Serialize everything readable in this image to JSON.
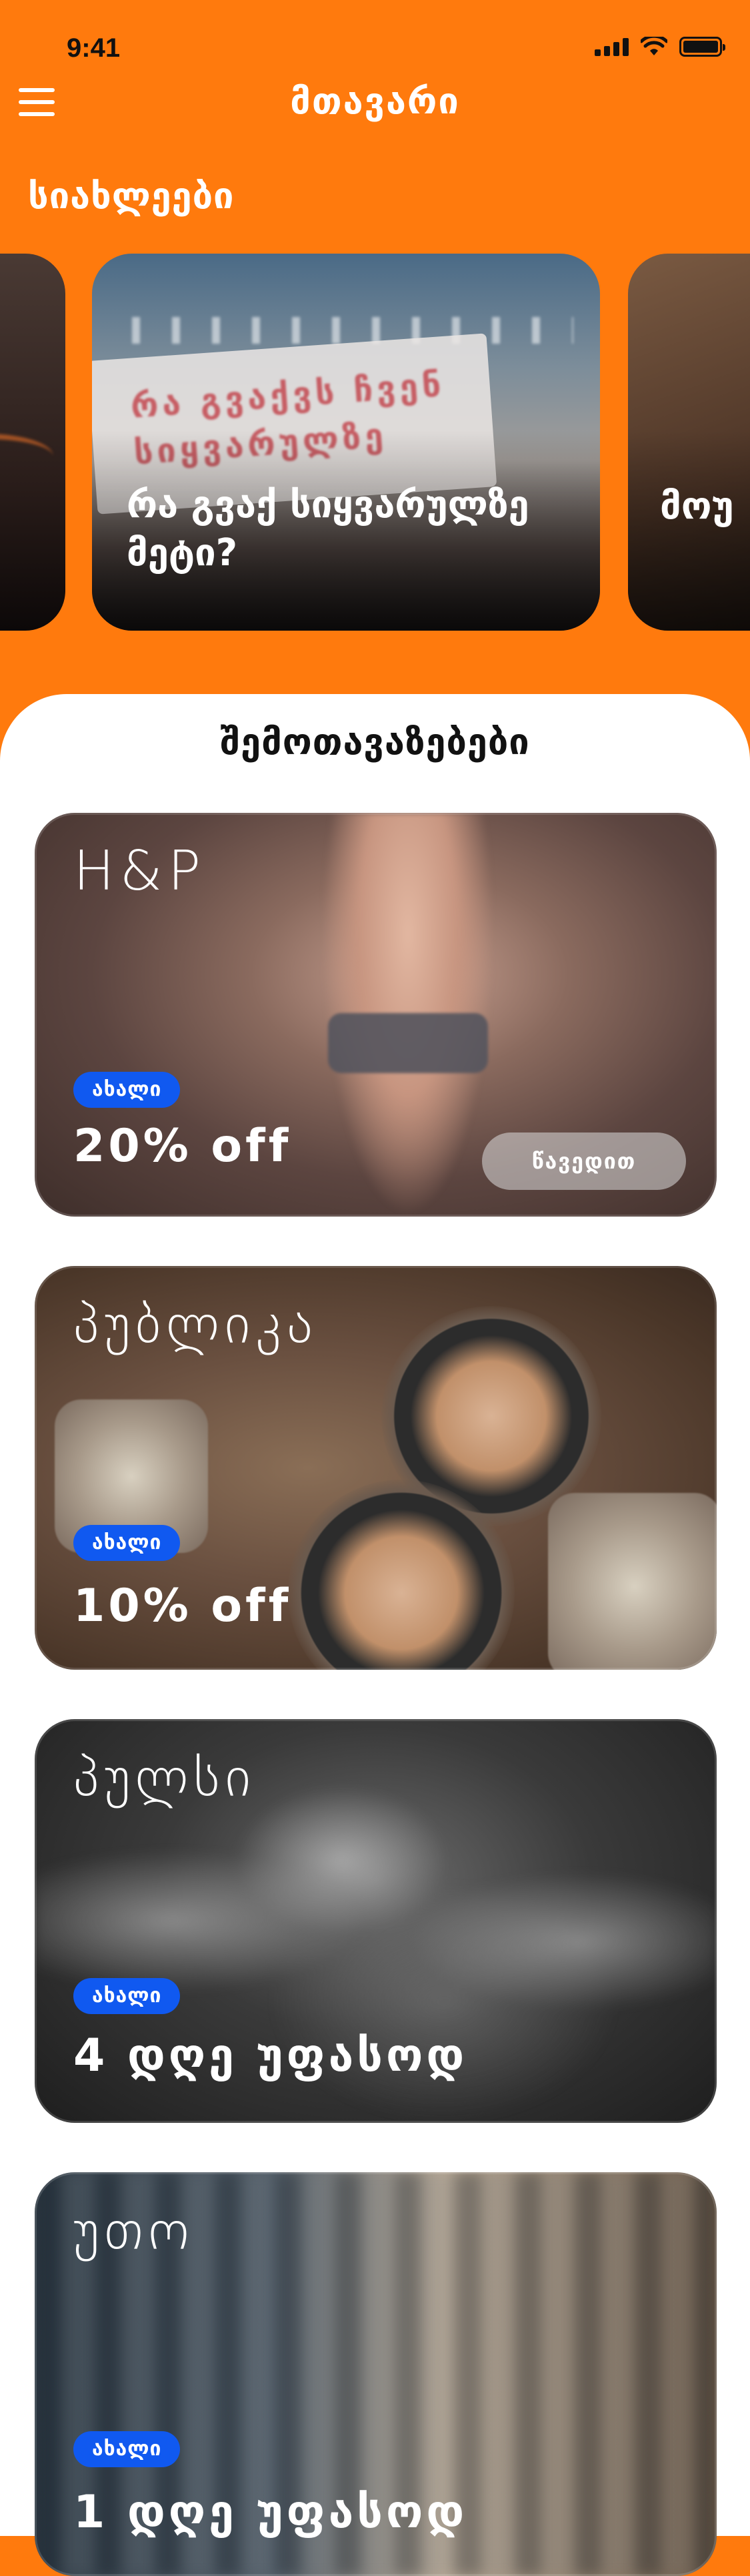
{
  "status_bar": {
    "time": "9:41"
  },
  "header": {
    "title": "მთავარი"
  },
  "news": {
    "section_title": "სიახლეები",
    "cards": [
      {
        "title": ""
      },
      {
        "title": "რა გვაქ სიყვარულზე მეტი?",
        "sign_text": "რა გვაქვს ჩვენ სიყვარულზე"
      },
      {
        "title": "მოუ"
      }
    ]
  },
  "offers": {
    "section_title": "შემოთავაზებები",
    "items": [
      {
        "brand": "H&P",
        "badge": "ახალი",
        "discount": "20% off",
        "button": "წავედით"
      },
      {
        "brand": "პუბლიკა",
        "badge": "ახალი",
        "discount": "10% off"
      },
      {
        "brand": "პულსი",
        "badge": "ახალი",
        "discount": "4 დღე უფასოდ"
      },
      {
        "brand": "უთო",
        "badge": "ახალი",
        "discount": "1 დღე უფასოდ"
      }
    ]
  },
  "colors": {
    "accent": "#ff7a0d",
    "badge": "#1059f0"
  }
}
